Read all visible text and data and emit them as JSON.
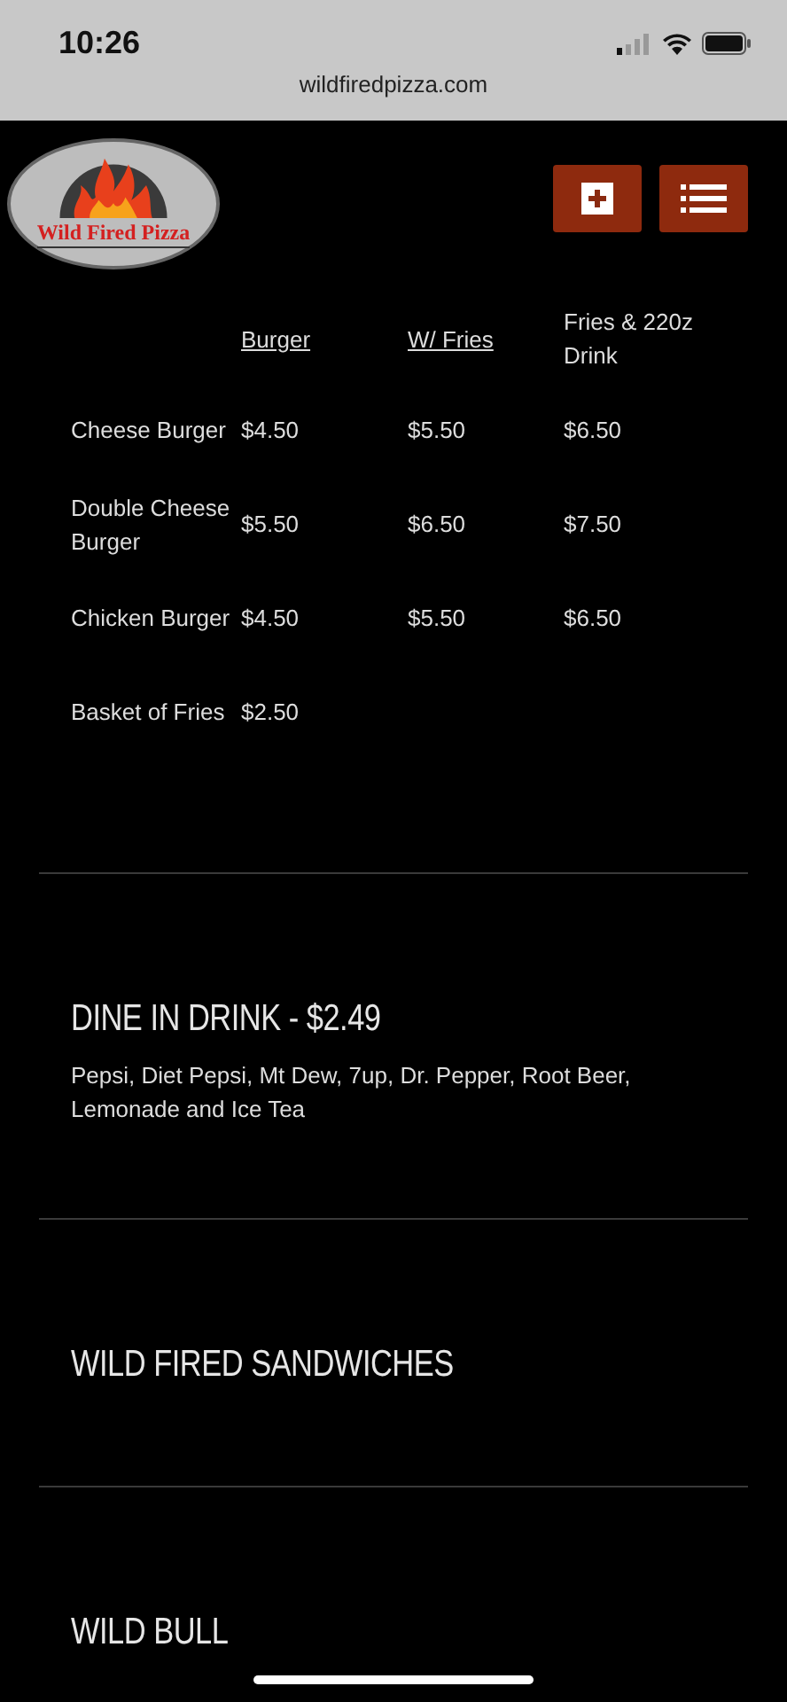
{
  "status_bar": {
    "time": "10:26",
    "url": "wildfiredpizza.com"
  },
  "header": {
    "logo_text": "Wild Fired Pizza"
  },
  "table": {
    "columns": [
      {
        "label": "Burger",
        "underlined": true
      },
      {
        "label": "W/ Fries",
        "underlined": true
      },
      {
        "label": "Fries & 220z Drink",
        "underlined": false
      }
    ],
    "rows": [
      {
        "name": "Cheese Burger",
        "prices": [
          "$4.50",
          "$5.50",
          "$6.50"
        ]
      },
      {
        "name": "Double Cheese Burger",
        "prices": [
          "$5.50",
          "$6.50",
          "$7.50"
        ]
      },
      {
        "name": "Chicken Burger",
        "prices": [
          "$4.50",
          "$5.50",
          "$6.50"
        ]
      },
      {
        "name": "Basket of Fries",
        "prices": [
          "$2.50"
        ]
      }
    ]
  },
  "sections": [
    {
      "heading": "DINE IN DRINK - $2.49",
      "description": "Pepsi, Diet Pepsi, Mt Dew, 7up, Dr. Pepper, Root Beer, Lemonade and Ice Tea"
    },
    {
      "heading": "WILD FIRED SANDWICHES"
    },
    {
      "heading": "WILD BULL"
    }
  ]
}
